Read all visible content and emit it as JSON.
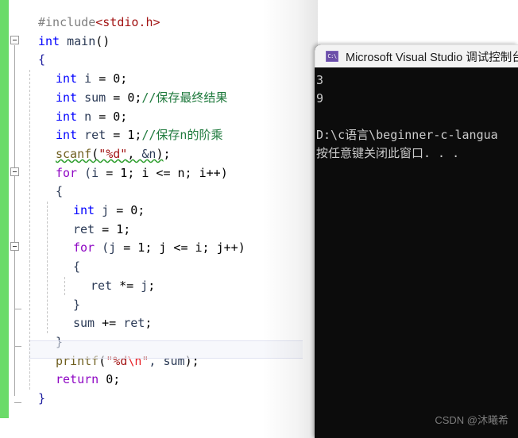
{
  "editor": {
    "name": "visual-studio-code-editor",
    "change_bar_color": "#6bdb69",
    "background": "#ffffff",
    "lines": [
      {
        "indent": 0,
        "tokens": [
          {
            "t": "#include",
            "c": "pre"
          },
          {
            "t": "<stdio.h>",
            "c": "inc"
          }
        ]
      },
      {
        "indent": 0,
        "tokens": [
          {
            "t": "int",
            "c": "kw"
          },
          {
            "t": " main",
            "c": "ident"
          },
          {
            "t": "()",
            "c": "punc"
          }
        ]
      },
      {
        "indent": 0,
        "tokens": [
          {
            "t": "{",
            "c": "brace1"
          }
        ]
      },
      {
        "indent": 1,
        "tokens": [
          {
            "t": "int",
            "c": "kw"
          },
          {
            "t": " i ",
            "c": "var"
          },
          {
            "t": "= ",
            "c": "punc"
          },
          {
            "t": "0",
            "c": "num"
          },
          {
            "t": ";",
            "c": "punc"
          }
        ]
      },
      {
        "indent": 1,
        "tokens": [
          {
            "t": "int",
            "c": "kw"
          },
          {
            "t": " sum ",
            "c": "var"
          },
          {
            "t": "= ",
            "c": "punc"
          },
          {
            "t": "0",
            "c": "num"
          },
          {
            "t": ";",
            "c": "punc"
          },
          {
            "t": "//保存最终结果",
            "c": "cmt"
          }
        ]
      },
      {
        "indent": 1,
        "tokens": [
          {
            "t": "int",
            "c": "kw"
          },
          {
            "t": " n ",
            "c": "var"
          },
          {
            "t": "= ",
            "c": "punc"
          },
          {
            "t": "0",
            "c": "num"
          },
          {
            "t": ";",
            "c": "punc"
          }
        ]
      },
      {
        "indent": 1,
        "tokens": [
          {
            "t": "int",
            "c": "kw"
          },
          {
            "t": " ret ",
            "c": "var"
          },
          {
            "t": "= ",
            "c": "punc"
          },
          {
            "t": "1",
            "c": "num"
          },
          {
            "t": ";",
            "c": "punc"
          },
          {
            "t": "//保存n的阶乘",
            "c": "cmt"
          }
        ]
      },
      {
        "indent": 1,
        "tokens": [
          {
            "t": "scanf",
            "c": "fn squig"
          },
          {
            "t": "(",
            "c": "punc squig"
          },
          {
            "t": "\"%d\"",
            "c": "str squig"
          },
          {
            "t": ", ",
            "c": "punc squig"
          },
          {
            "t": "&n",
            "c": "var squig"
          },
          {
            "t": ")",
            "c": "punc squig"
          },
          {
            "t": ";",
            "c": "punc"
          }
        ]
      },
      {
        "indent": 1,
        "tokens": [
          {
            "t": "for",
            "c": "ctl"
          },
          {
            "t": " (i ",
            "c": "var"
          },
          {
            "t": "= ",
            "c": "punc"
          },
          {
            "t": "1",
            "c": "num"
          },
          {
            "t": "; i <= n; i++)",
            "c": "punc"
          }
        ]
      },
      {
        "indent": 1,
        "tokens": [
          {
            "t": "{",
            "c": "brace2"
          }
        ]
      },
      {
        "indent": 2,
        "tokens": [
          {
            "t": "int",
            "c": "kw"
          },
          {
            "t": " j ",
            "c": "var"
          },
          {
            "t": "= ",
            "c": "punc"
          },
          {
            "t": "0",
            "c": "num"
          },
          {
            "t": ";",
            "c": "punc"
          }
        ]
      },
      {
        "indent": 2,
        "tokens": [
          {
            "t": "ret ",
            "c": "var"
          },
          {
            "t": "= ",
            "c": "punc"
          },
          {
            "t": "1",
            "c": "num"
          },
          {
            "t": ";",
            "c": "punc"
          }
        ]
      },
      {
        "indent": 2,
        "tokens": [
          {
            "t": "for",
            "c": "ctl"
          },
          {
            "t": " (j ",
            "c": "var"
          },
          {
            "t": "= ",
            "c": "punc"
          },
          {
            "t": "1",
            "c": "num"
          },
          {
            "t": "; j <= i; j++)",
            "c": "punc"
          }
        ]
      },
      {
        "indent": 2,
        "tokens": [
          {
            "t": "{",
            "c": "brace2"
          }
        ]
      },
      {
        "indent": 3,
        "tokens": [
          {
            "t": "ret ",
            "c": "var"
          },
          {
            "t": "*= ",
            "c": "punc"
          },
          {
            "t": "j",
            "c": "var"
          },
          {
            "t": ";",
            "c": "punc"
          }
        ]
      },
      {
        "indent": 2,
        "tokens": [
          {
            "t": "}",
            "c": "brace2"
          }
        ]
      },
      {
        "indent": 2,
        "tokens": [
          {
            "t": "sum ",
            "c": "var"
          },
          {
            "t": "+= ",
            "c": "punc"
          },
          {
            "t": "ret",
            "c": "var"
          },
          {
            "t": ";",
            "c": "punc"
          }
        ]
      },
      {
        "indent": 1,
        "tokens": [
          {
            "t": "}",
            "c": "brace2"
          }
        ]
      },
      {
        "indent": 1,
        "tokens": [
          {
            "t": "printf",
            "c": "fn"
          },
          {
            "t": "(",
            "c": "punc"
          },
          {
            "t": "\"%d",
            "c": "str"
          },
          {
            "t": "\\n",
            "c": "esc"
          },
          {
            "t": "\"",
            "c": "str"
          },
          {
            "t": ", sum",
            "c": "var"
          },
          {
            "t": ")",
            "c": "punc"
          },
          {
            "t": ";",
            "c": "punc"
          }
        ]
      },
      {
        "indent": 1,
        "tokens": [
          {
            "t": "return",
            "c": "ctl"
          },
          {
            "t": " ",
            "c": "punc"
          },
          {
            "t": "0",
            "c": "num"
          },
          {
            "t": ";",
            "c": "punc"
          }
        ]
      },
      {
        "indent": 0,
        "tokens": [
          {
            "t": "}",
            "c": "brace1"
          }
        ]
      }
    ],
    "fold_markers": [
      {
        "line": 1,
        "collapsible": true
      },
      {
        "line": 8,
        "collapsible": true
      },
      {
        "line": 12,
        "collapsible": true
      }
    ],
    "current_line_index": 17
  },
  "console": {
    "window_title": "Microsoft Visual Studio 调试控制台",
    "icon": "console-app-icon",
    "icon_glyph": "C:\\",
    "background": "#0c0c0c",
    "text_color": "#cccccc",
    "lines": [
      "3",
      "9",
      "",
      "D:\\c语言\\beginner-c-langua",
      "按任意键关闭此窗口. . ."
    ]
  },
  "watermark": {
    "text": "CSDN @沐曦希"
  }
}
